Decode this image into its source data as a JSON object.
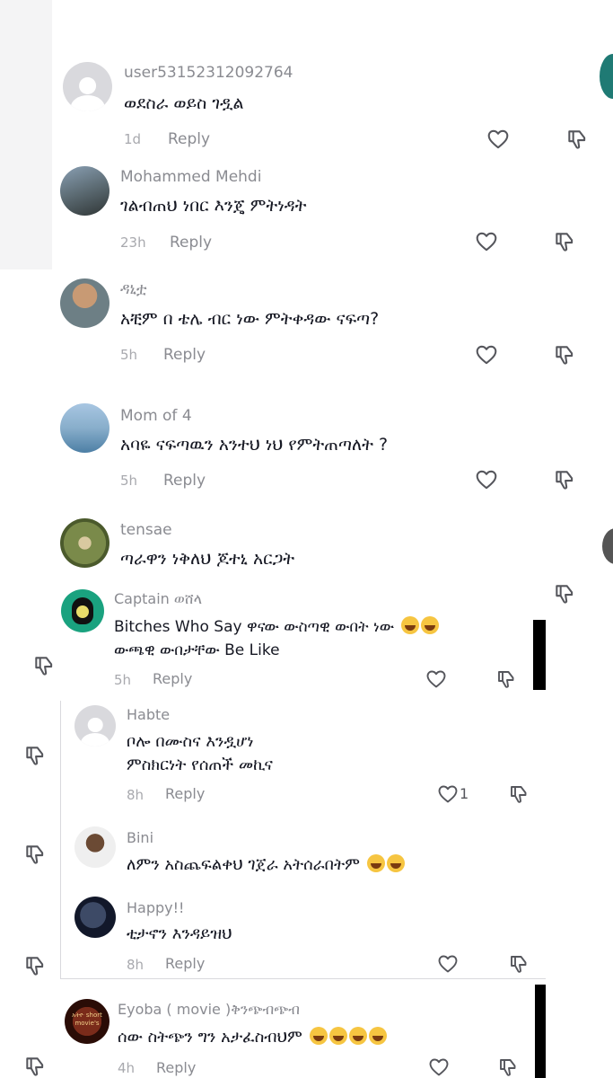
{
  "comments_back": [
    {
      "user": "user53152312092764",
      "text": "ወደስራ ወይስ ገዷል",
      "time": "1d",
      "reply": "Reply"
    },
    {
      "user": "Mohammed Mehdi",
      "text": "ገልብጠህ ነበር እንጄ ምትነዳት",
      "time": "23h",
      "reply": "Reply"
    },
    {
      "user": "ዳኒቷ",
      "text": "አቺም በ ቴሌ ብር ነው ምትቀዳው ናፍጣ?",
      "time": "5h",
      "reply": "Reply"
    },
    {
      "user": "Mom of 4",
      "text": "አባዬ ናፍጣዉን አንተህ ነህ የምትጠጣለት ?",
      "time": "5h",
      "reply": "Reply"
    },
    {
      "user": "tensae",
      "text": "ጣራዋን ነቅለህ ጆተኒ አርጋት"
    }
  ],
  "comment_main": {
    "user": "Captain ወሸላ",
    "text_line1": "Bitches Who Say ዋናው ውስጣዊ ውበት ነው",
    "text_line2": "ውጫዊ ውበታቸው Be Like",
    "time": "5h",
    "reply": "Reply"
  },
  "replies": [
    {
      "user": "Habte",
      "text_line1": "ቦሎ በሙስና እንዷሆነ",
      "text_line2": "ምስክርነት የሰጠች መኪና",
      "time": "8h",
      "reply": "Reply",
      "likes": "1"
    },
    {
      "user": "Bini",
      "text": "ለምን አስጨፍልቀህ ገጀራ አትሰራበትም"
    },
    {
      "user": "Happy!!",
      "text": "ቲታኖን እንዳይዝህ",
      "time": "8h",
      "reply": "Reply"
    }
  ],
  "comment_bottom": {
    "user": "Eyoba ( movie )ቅንጭብጭብ",
    "avatar_text": "አትዮ short movie's",
    "text": "ሰው ስትጭን ግን አታፈስብህም",
    "time": "4h",
    "reply": "Reply"
  },
  "icons": [
    "heart-icon",
    "dislike-icon",
    "profile-placeholder-icon"
  ],
  "colors": {
    "text": "#161823",
    "muted": "#8a8b91",
    "time": "#a8a9ae",
    "emoji": "#f6c541"
  }
}
